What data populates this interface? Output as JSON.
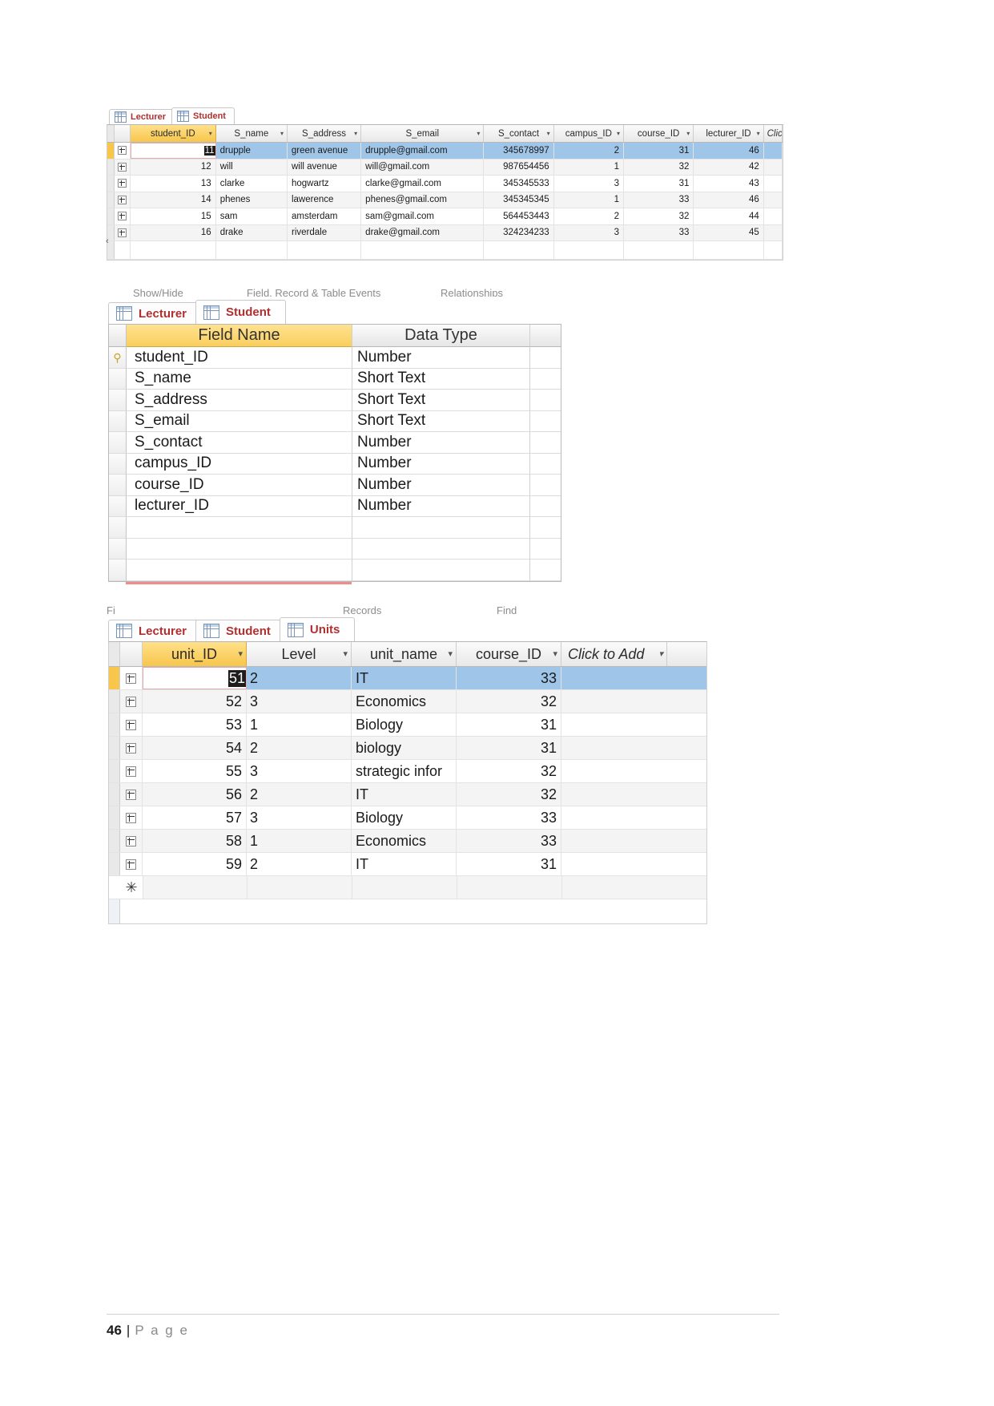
{
  "page": {
    "number": "46",
    "separator": "|",
    "label": "P a g e"
  },
  "panel_student_datasheet": {
    "tabs": [
      {
        "label": "Lecturer",
        "icon": "table-icon",
        "active": false
      },
      {
        "label": "Student",
        "icon": "table-icon",
        "active": true
      }
    ],
    "columns": [
      {
        "label": "student_ID",
        "key": true,
        "align": "num"
      },
      {
        "label": "S_name",
        "key": false,
        "align": "txt"
      },
      {
        "label": "S_address",
        "key": false,
        "align": "txt"
      },
      {
        "label": "S_email",
        "key": false,
        "align": "txt"
      },
      {
        "label": "S_contact",
        "key": false,
        "align": "num"
      },
      {
        "label": "campus_ID",
        "key": false,
        "align": "num"
      },
      {
        "label": "course_ID",
        "key": false,
        "align": "num"
      },
      {
        "label": "lecturer_ID",
        "key": false,
        "align": "num"
      },
      {
        "label": "Clic",
        "key": false,
        "align": "txt"
      }
    ],
    "rows": [
      {
        "student_ID": "11",
        "S_name": "drupple",
        "S_address": "green avenue",
        "S_email": "drupple@gmail.com",
        "S_contact": "345678997",
        "campus_ID": "2",
        "course_ID": "31",
        "lecturer_ID": "46",
        "selected": true,
        "editing": true
      },
      {
        "student_ID": "12",
        "S_name": "will",
        "S_address": "will avenue",
        "S_email": "will@gmail.com",
        "S_contact": "987654456",
        "campus_ID": "1",
        "course_ID": "32",
        "lecturer_ID": "42",
        "selected": false,
        "editing": false
      },
      {
        "student_ID": "13",
        "S_name": "clarke",
        "S_address": "hogwartz",
        "S_email": "clarke@gmail.com",
        "S_contact": "345345533",
        "campus_ID": "3",
        "course_ID": "31",
        "lecturer_ID": "43",
        "selected": false,
        "editing": false
      },
      {
        "student_ID": "14",
        "S_name": "phenes",
        "S_address": "lawerence",
        "S_email": "phenes@gmail.com",
        "S_contact": "345345345",
        "campus_ID": "1",
        "course_ID": "33",
        "lecturer_ID": "46",
        "selected": false,
        "editing": false
      },
      {
        "student_ID": "15",
        "S_name": "sam",
        "S_address": "amsterdam",
        "S_email": "sam@gmail.com",
        "S_contact": "564453443",
        "campus_ID": "2",
        "course_ID": "32",
        "lecturer_ID": "44",
        "selected": false,
        "editing": false
      },
      {
        "student_ID": "16",
        "S_name": "drake",
        "S_address": "riverdale",
        "S_email": "drake@gmail.com",
        "S_contact": "324234233",
        "campus_ID": "3",
        "course_ID": "33",
        "lecturer_ID": "45",
        "selected": false,
        "editing": false
      }
    ]
  },
  "panel_student_design": {
    "ribbon_ghost": [
      {
        "label": "Show/Hide"
      },
      {
        "label": "Field, Record & Table Events"
      },
      {
        "label": "Relationships"
      }
    ],
    "tabs": [
      {
        "label": "Lecturer",
        "icon": "table-icon",
        "active": false
      },
      {
        "label": "Student",
        "icon": "table-icon",
        "active": true
      }
    ],
    "headers": {
      "field_name": "Field Name",
      "data_type": "Data Type"
    },
    "fields": [
      {
        "name": "student_ID",
        "type": "Number",
        "primary_key": true
      },
      {
        "name": "S_name",
        "type": "Short Text",
        "primary_key": false
      },
      {
        "name": "S_address",
        "type": "Short Text",
        "primary_key": false
      },
      {
        "name": "S_email",
        "type": "Short Text",
        "primary_key": false
      },
      {
        "name": "S_contact",
        "type": "Number",
        "primary_key": false
      },
      {
        "name": "campus_ID",
        "type": "Number",
        "primary_key": false
      },
      {
        "name": "course_ID",
        "type": "Number",
        "primary_key": false
      },
      {
        "name": "lecturer_ID",
        "type": "Number",
        "primary_key": false
      },
      {
        "name": "",
        "type": "",
        "primary_key": false
      },
      {
        "name": "",
        "type": "",
        "primary_key": false
      },
      {
        "name": "",
        "type": "",
        "primary_key": false
      }
    ]
  },
  "panel_units_datasheet": {
    "ribbon_ghost": [
      {
        "label": "Fi"
      },
      {
        "label": "Records"
      },
      {
        "label": "Find"
      }
    ],
    "tabs": [
      {
        "label": "Lecturer",
        "icon": "table-icon",
        "active": false
      },
      {
        "label": "Student",
        "icon": "table-icon",
        "active": false
      },
      {
        "label": "Units",
        "icon": "table-icon",
        "active": true
      }
    ],
    "columns": [
      {
        "label": "unit_ID",
        "key": true,
        "align": "num"
      },
      {
        "label": "Level",
        "key": false,
        "align": "txt"
      },
      {
        "label": "unit_name",
        "key": false,
        "align": "txt"
      },
      {
        "label": "course_ID",
        "key": false,
        "align": "num"
      },
      {
        "label": "Click to Add",
        "key": false,
        "align": "txt"
      }
    ],
    "rows": [
      {
        "unit_ID": "51",
        "Level": "2",
        "unit_name": "IT",
        "course_ID": "33",
        "selected": true,
        "editing": true
      },
      {
        "unit_ID": "52",
        "Level": "3",
        "unit_name": "Economics",
        "course_ID": "32",
        "selected": false,
        "editing": false
      },
      {
        "unit_ID": "53",
        "Level": "1",
        "unit_name": "Biology",
        "course_ID": "31",
        "selected": false,
        "editing": false
      },
      {
        "unit_ID": "54",
        "Level": "2",
        "unit_name": "biology",
        "course_ID": "31",
        "selected": false,
        "editing": false
      },
      {
        "unit_ID": "55",
        "Level": "3",
        "unit_name": "strategic infor",
        "course_ID": "32",
        "selected": false,
        "editing": false
      },
      {
        "unit_ID": "56",
        "Level": "2",
        "unit_name": "IT",
        "course_ID": "32",
        "selected": false,
        "editing": false
      },
      {
        "unit_ID": "57",
        "Level": "3",
        "unit_name": "Biology",
        "course_ID": "33",
        "selected": false,
        "editing": false
      },
      {
        "unit_ID": "58",
        "Level": "1",
        "unit_name": "Economics",
        "course_ID": "33",
        "selected": false,
        "editing": false
      },
      {
        "unit_ID": "59",
        "Level": "2",
        "unit_name": "IT",
        "course_ID": "31",
        "selected": false,
        "editing": false
      }
    ],
    "new_record_glyph": "✳"
  },
  "colors": {
    "key_header": "#f7c64b",
    "selected_row": "#9fc6e8",
    "tab_text": "#b03030",
    "edit_border": "#e8a9ae",
    "grid_line": "#e3e3e3"
  }
}
